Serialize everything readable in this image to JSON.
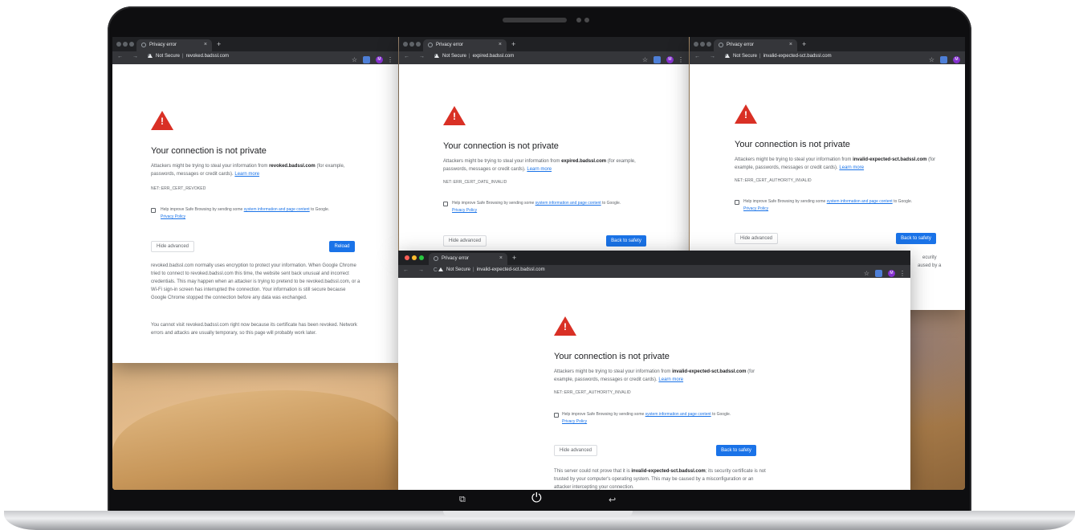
{
  "common": {
    "tab_title": "Privacy error",
    "tab_close": "×",
    "new_tab": "+",
    "nav": "← → C",
    "not_secure": "Not Secure",
    "separator": "|",
    "star": "☆",
    "menu": "⋮",
    "profile_initial": "M",
    "heading": "Your connection is not private",
    "attack_intro": "Attackers might be trying to steal your information from",
    "for_example": "(for example, passwords, messages or credit cards).",
    "learn_more": "Learn more",
    "safe_browsing_pre": "Help improve Safe Browsing by sending some",
    "safe_browsing_link": "system information and page content",
    "safe_browsing_post": "to Google.",
    "privacy_policy": "Privacy Policy",
    "hide_advanced": "Hide advanced"
  },
  "windows": [
    {
      "url": "revoked.badssl.com",
      "host": "revoked.badssl.com",
      "error_code": "NET::ERR_CERT_REVOKED",
      "primary_button": "Reload",
      "details": [
        "revoked.badssl.com normally uses encryption to protect your information. When Google Chrome tried to connect to revoked.badssl.com this time, the website sent back unusual and incorrect credentials. This may happen when an attacker is trying to pretend to be revoked.badssl.com, or a Wi-Fi sign-in screen has interrupted the connection. Your information is still secure because Google Chrome stopped the connection before any data was exchanged.",
        "You cannot visit revoked.badssl.com right now because its certificate has been revoked. Network errors and attacks are usually temporary, so this page will probably work later."
      ]
    },
    {
      "url": "expired.badssl.com",
      "host": "expired.badssl.com",
      "error_code": "NET::ERR_CERT_DATE_INVALID",
      "primary_button": "Back to safety"
    },
    {
      "url": "invalid-expected-sct.badssl.com",
      "host": "invalid-expected-sct.badssl.com",
      "error_code": "NET::ERR_CERT_AUTHORITY_INVALID",
      "primary_button": "Back to safety",
      "peek_text": [
        "ecurity",
        "aused by a"
      ]
    },
    {
      "url": "invalid-expected-sct.badssl.com",
      "host": "invalid-expected-sct.badssl.com",
      "error_code": "NET::ERR_CERT_AUTHORITY_INVALID",
      "primary_button": "Back to safety",
      "detail_pre": "This server could not prove that it is",
      "detail_host": "invalid-expected-sct.badssl.com",
      "detail_post": "; its security certificate is not trusted by your computer's operating system. This may be caused by a misconfiguration or an attacker intercepting your connection."
    }
  ],
  "dock": {
    "left_icon": "⧉",
    "power_icon": "⏻",
    "back_icon": "↩"
  },
  "colors": {
    "danger": "#d93025",
    "primary": "#1a73e8",
    "tabbar": "#202124",
    "toolbar": "#35363a"
  }
}
